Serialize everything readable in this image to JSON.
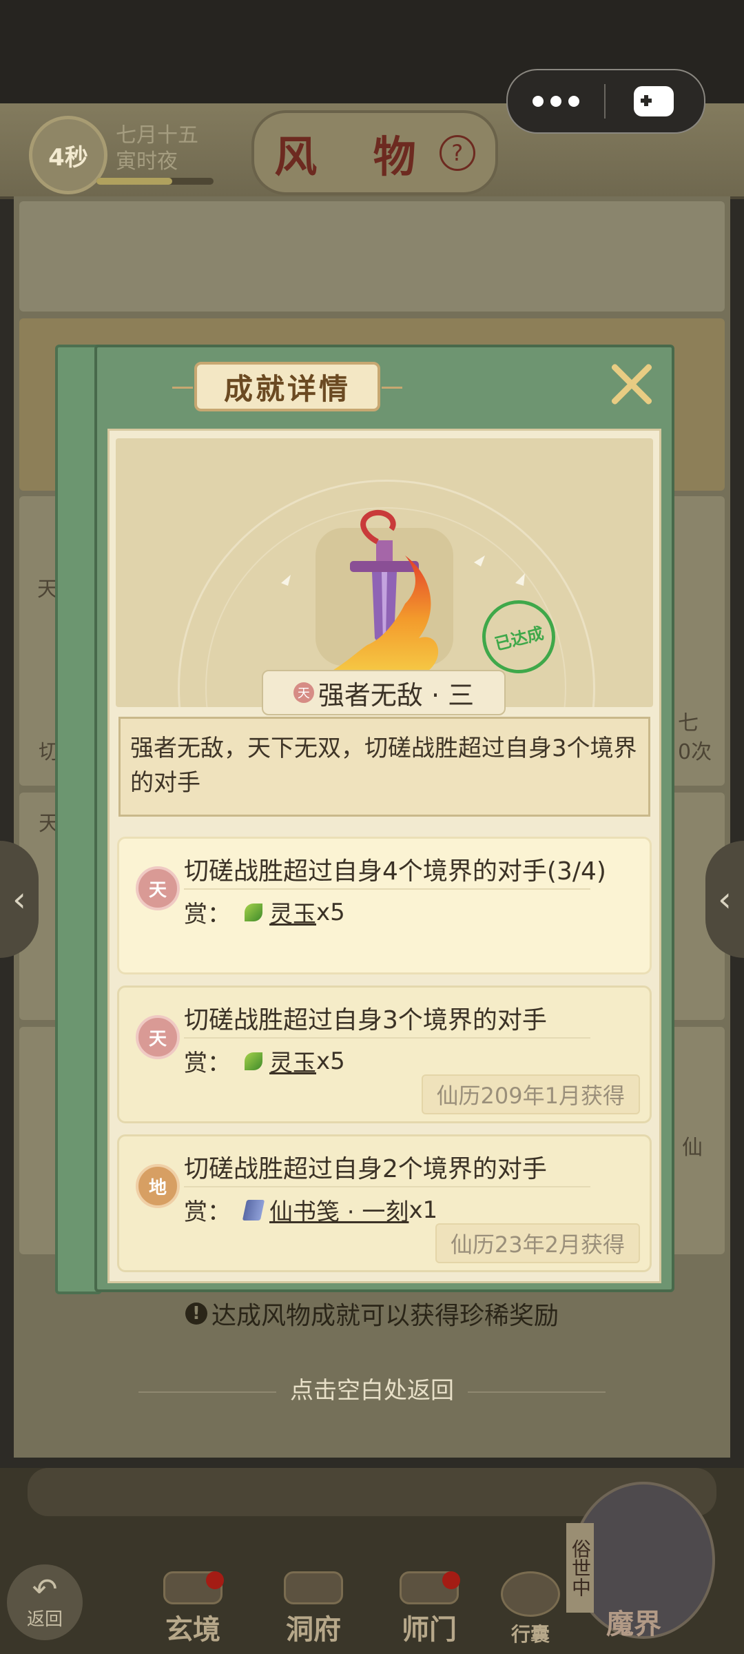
{
  "header": {
    "timer": "4秒",
    "date_line1": "七月十五",
    "date_line2": "寅时夜",
    "title": "风 物",
    "help_symbol": "?"
  },
  "system_menu": {
    "more_icon": "more-dots-icon",
    "game_icon": "gamepad-icon"
  },
  "background": {
    "side_labels": [
      "天",
      "切",
      "天",
      "0次",
      "七",
      "仙"
    ],
    "message": "达成风物成就可以获得珍稀奖励",
    "message_icon": "!",
    "tap_return": "点击空白处返回"
  },
  "modal": {
    "title": "成就详情",
    "achievement_badge": "天",
    "achievement_name": "强者无敌 · 三",
    "achieved_stamp": "已达成",
    "description": "强者无敌，天下无双，切磋战胜超过自身3个境界的对手",
    "reward_prefix": "赏：",
    "tasks": [
      {
        "badge": "天",
        "title": "切磋战胜超过自身4个境界的对手(3/4)",
        "reward_name": "灵玉",
        "reward_qty": "x5",
        "obtained": ""
      },
      {
        "badge": "天",
        "title": "切磋战胜超过自身3个境界的对手",
        "reward_name": "灵玉",
        "reward_qty": "x5",
        "obtained": "仙历209年1月获得"
      },
      {
        "badge": "地",
        "title": "切磋战胜超过自身2个境界的对手",
        "reward_name": "仙书笺 · 一刻",
        "reward_qty": "x1",
        "obtained": "仙历23年2月获得"
      }
    ]
  },
  "bottom_nav": {
    "back": "返回",
    "items": [
      "玄境",
      "洞府",
      "师门",
      "行囊",
      "魔界"
    ],
    "secular_tag": "俗世中"
  },
  "colors": {
    "modal_green": "#6e9571",
    "parchment": "#f2ead0",
    "stamp_green": "#3fa84a",
    "title_brown": "#6b4a22"
  }
}
